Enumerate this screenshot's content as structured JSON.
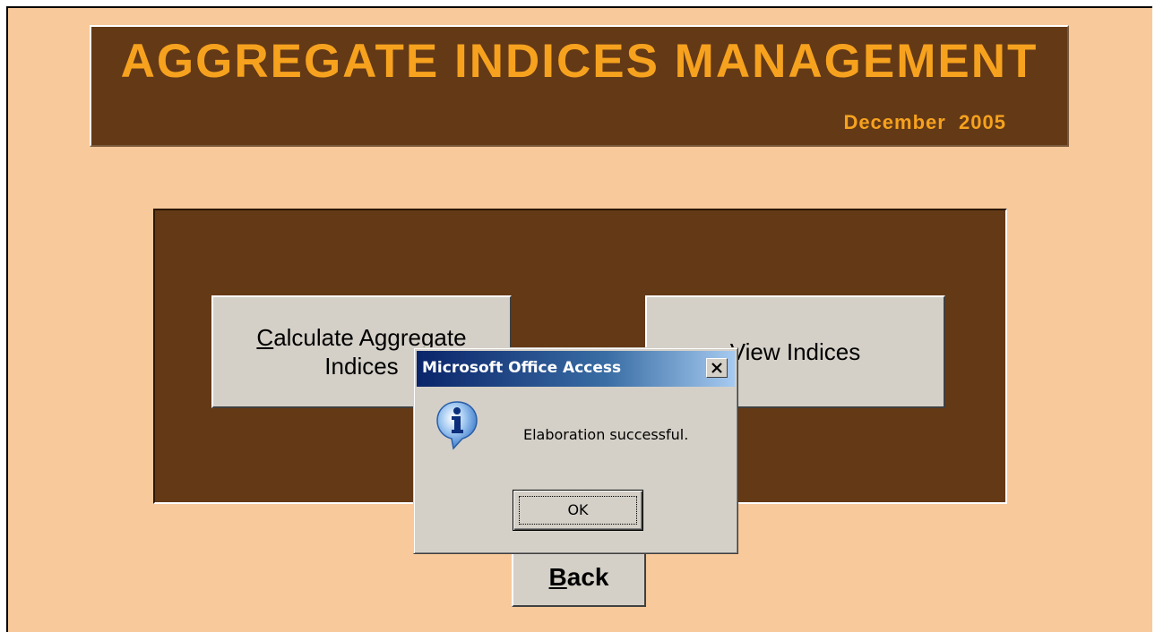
{
  "header": {
    "title": "AGGREGATE INDICES MANAGEMENT",
    "date": "December  2005"
  },
  "buttons": {
    "calculate_line1_first": "C",
    "calculate_line1_rest": "alculate Aggregate",
    "calculate_line2": "Indices",
    "view_indices": "View Indices",
    "back_first": "B",
    "back_rest": "ack"
  },
  "dialog": {
    "title": "Microsoft Office Access",
    "message": "Elaboration successful.",
    "ok_label": "OK",
    "icon": "info-icon"
  },
  "colors": {
    "form_background": "#f8c99a",
    "panel_brown": "#643916",
    "title_orange": "#f6a21e",
    "button_face": "#d4d0c8"
  }
}
